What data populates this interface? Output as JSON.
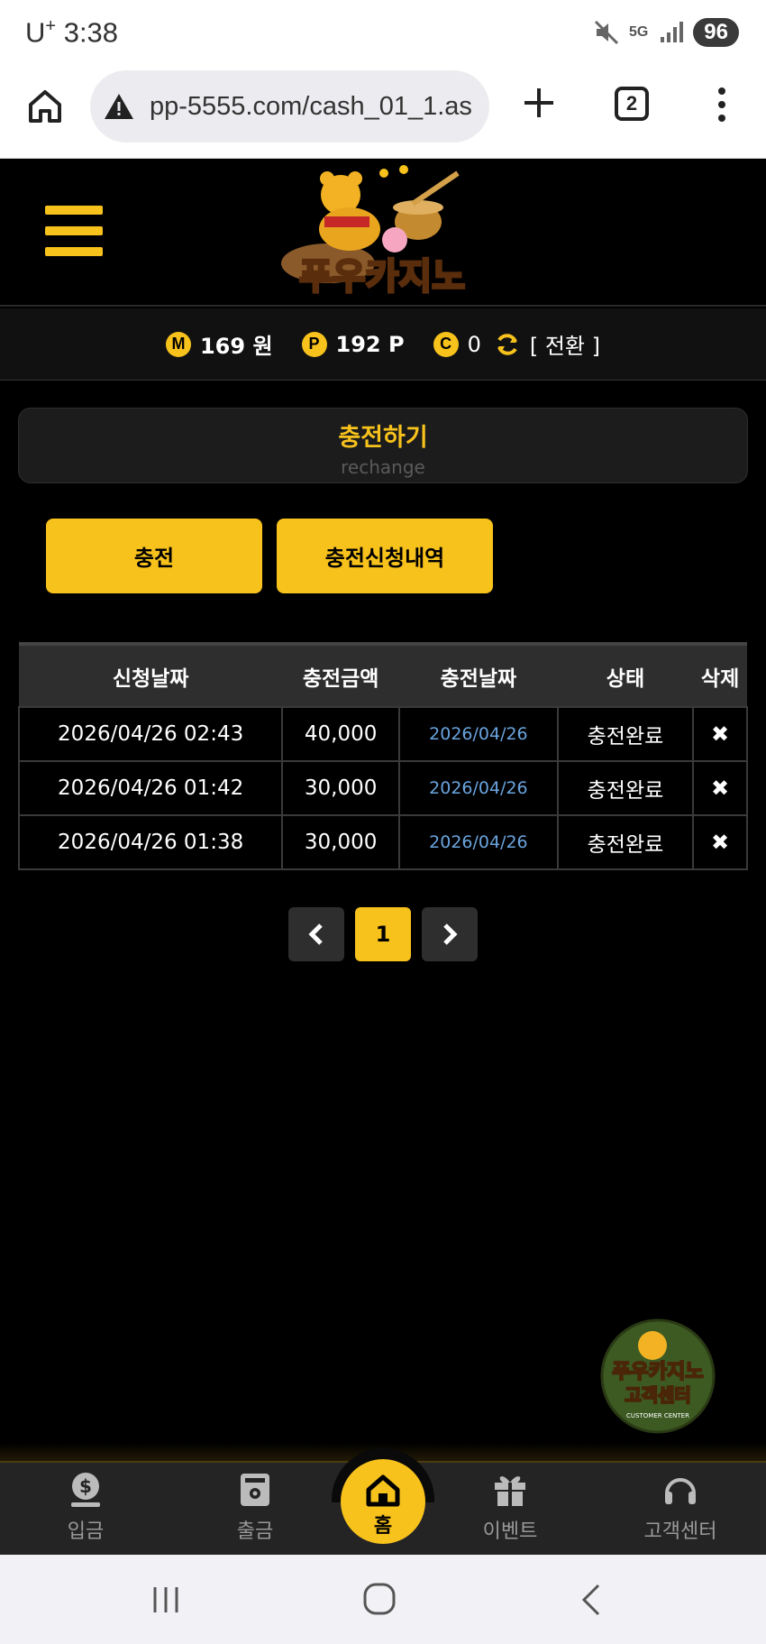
{
  "status_bar": {
    "carrier": "U",
    "carrier_sup": "+",
    "time": "3:38",
    "network": "5G",
    "battery": "96"
  },
  "browser": {
    "url": "pp-5555.com/cash_01_1.as",
    "tab_count": "2"
  },
  "header": {
    "logo_text": "푸우카지노"
  },
  "balance": {
    "money_icon": "M",
    "money_value": "169 원",
    "point_icon": "P",
    "point_value": "192 P",
    "casino_icon": "C",
    "casino_value": "0",
    "convert_label": "[ 전환 ]"
  },
  "page_title": {
    "korean": "충전하기",
    "english": "rechange"
  },
  "buttons": {
    "charge": "충전",
    "history": "충전신청내역"
  },
  "table": {
    "headers": [
      "신청날짜",
      "충전금액",
      "충전날짜",
      "상태",
      "삭제"
    ],
    "rows": [
      {
        "request_date": "2026/04/26 02:43",
        "amount": "40,000",
        "charge_date": "2026/04/26",
        "status": "충전완료",
        "delete": "✖"
      },
      {
        "request_date": "2026/04/26 01:42",
        "amount": "30,000",
        "charge_date": "2026/04/26",
        "status": "충전완료",
        "delete": "✖"
      },
      {
        "request_date": "2026/04/26 01:38",
        "amount": "30,000",
        "charge_date": "2026/04/26",
        "status": "충전완료",
        "delete": "✖"
      }
    ]
  },
  "pagination": {
    "current": "1"
  },
  "customer_center_float": {
    "title": "푸우카지노",
    "subtitle": "고객센터",
    "caption": "CUSTOMER CENTER"
  },
  "bottom_nav": {
    "deposit": "입금",
    "withdraw": "출금",
    "home": "홈",
    "event": "이벤트",
    "support": "고객센터"
  },
  "colors": {
    "accent": "#f8c21c",
    "background": "#000000",
    "link_blue": "#6aa4de"
  }
}
